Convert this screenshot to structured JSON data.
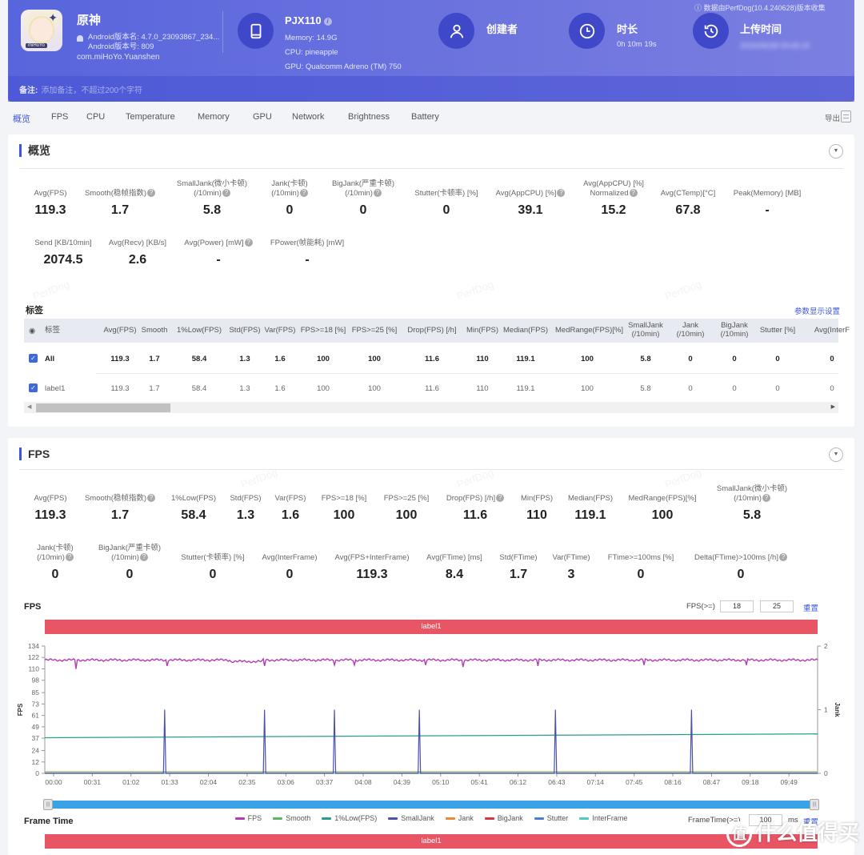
{
  "header": {
    "app": {
      "name": "原神",
      "version_name": "Android版本名: 4.7.0_23093867_234...",
      "version_code": "Android版本号: 809",
      "package": "com.miHoYo.Yuanshen",
      "icon_tag": "miHoYo"
    },
    "device": {
      "model": "PJX110",
      "memory": "Memory: 14.9G",
      "cpu": "CPU: pineapple",
      "gpu": "GPU: Qualcomm Adreno (TM) 750"
    },
    "creator": {
      "title": "创建者",
      "value": ""
    },
    "duration": {
      "title": "时长",
      "value": "0h 10m 19s"
    },
    "upload": {
      "title": "上传时间",
      "value": "2024/06/28 09:46:15"
    },
    "collected_by": "数据由PerfDog(10.4.240628)版本收集",
    "note_label": "备注:",
    "note_placeholder": "添加备注，不超过200个字符"
  },
  "tabs": [
    "概览",
    "FPS",
    "CPU",
    "Temperature",
    "Memory",
    "GPU",
    "Network",
    "Brightness",
    "Battery"
  ],
  "active_tab": "概览",
  "export_label": "导出",
  "overview": {
    "title": "概览",
    "metrics_row1": [
      {
        "label": "Avg(FPS)",
        "value": "119.3",
        "help": false
      },
      {
        "label": "Smooth(稳帧指数)",
        "value": "1.7",
        "help": true
      },
      {
        "label": "SmallJank(微小卡顿)\n(/10min)",
        "value": "5.8",
        "help": true
      },
      {
        "label": "Jank(卡顿)\n(/10min)",
        "value": "0",
        "help": true
      },
      {
        "label": "BigJank(严重卡顿)\n(/10min)",
        "value": "0",
        "help": true
      },
      {
        "label": "Stutter(卡顿率) [%]",
        "value": "0",
        "help": false
      },
      {
        "label": "Avg(AppCPU) [%]",
        "value": "39.1",
        "help": true
      },
      {
        "label": "Avg(AppCPU) [%]\nNormalized",
        "value": "15.2",
        "help": true
      },
      {
        "label": "Avg(CTemp)[°C]",
        "value": "67.8",
        "help": false
      },
      {
        "label": "Peak(Memory) [MB]",
        "value": "-",
        "help": false
      }
    ],
    "metrics_row2": [
      {
        "label": "Send [KB/10min]",
        "value": "2074.5",
        "help": false
      },
      {
        "label": "Avg(Recv) [KB/s]",
        "value": "2.6",
        "help": false
      },
      {
        "label": "Avg(Power) [mW]",
        "value": "-",
        "help": true
      },
      {
        "label": "FPower(帧能耗) [mW]",
        "value": "-",
        "help": false
      }
    ],
    "tags_title": "标签",
    "param_settings": "参数显示设置",
    "table": {
      "columns": [
        "标签",
        "Avg(FPS)",
        "Smooth",
        "1%Low(FPS)",
        "Std(FPS)",
        "Var(FPS)",
        "FPS>=18 [%]",
        "FPS>=25 [%]",
        "Drop(FPS) [/h]",
        "Min(FPS)",
        "Median(FPS)",
        "MedRange(FPS)[%]",
        "SmallJank\n(/10min)",
        "Jank\n(/10min)",
        "BigJank\n(/10min)",
        "Stutter [%]",
        "Avg(InterF"
      ],
      "rows": [
        {
          "name": "All",
          "checked": true,
          "values": [
            "119.3",
            "1.7",
            "58.4",
            "1.3",
            "1.6",
            "100",
            "100",
            "11.6",
            "110",
            "119.1",
            "100",
            "5.8",
            "0",
            "0",
            "0",
            "0"
          ]
        },
        {
          "name": "label1",
          "checked": true,
          "values": [
            "119.3",
            "1.7",
            "58.4",
            "1.3",
            "1.6",
            "100",
            "100",
            "11.6",
            "110",
            "119.1",
            "100",
            "5.8",
            "0",
            "0",
            "0",
            "0"
          ]
        }
      ]
    }
  },
  "fps_section": {
    "title": "FPS",
    "metrics_row1": [
      {
        "label": "Avg(FPS)",
        "value": "119.3",
        "help": false
      },
      {
        "label": "Smooth(稳帧指数)",
        "value": "1.7",
        "help": true
      },
      {
        "label": "1%Low(FPS)",
        "value": "58.4",
        "help": false
      },
      {
        "label": "Std(FPS)",
        "value": "1.3",
        "help": false
      },
      {
        "label": "Var(FPS)",
        "value": "1.6",
        "help": false
      },
      {
        "label": "FPS>=18 [%]",
        "value": "100",
        "help": false
      },
      {
        "label": "FPS>=25 [%]",
        "value": "100",
        "help": false
      },
      {
        "label": "Drop(FPS) [/h]",
        "value": "11.6",
        "help": true
      },
      {
        "label": "Min(FPS)",
        "value": "110",
        "help": false
      },
      {
        "label": "Median(FPS)",
        "value": "119.1",
        "help": false
      },
      {
        "label": "MedRange(FPS)[%]",
        "value": "100",
        "help": false
      },
      {
        "label": "SmallJank(微小卡顿)\n(/10min)",
        "value": "5.8",
        "help": true
      }
    ],
    "metrics_row2": [
      {
        "label": "Jank(卡顿)\n(/10min)",
        "value": "0",
        "help": true
      },
      {
        "label": "BigJank(严重卡顿)\n(/10min)",
        "value": "0",
        "help": true
      },
      {
        "label": "Stutter(卡顿率) [%]",
        "value": "0",
        "help": false
      },
      {
        "label": "Avg(InterFrame)",
        "value": "0",
        "help": false
      },
      {
        "label": "Avg(FPS+InterFrame)",
        "value": "119.3",
        "help": false
      },
      {
        "label": "Avg(FTime) [ms]",
        "value": "8.4",
        "help": false
      },
      {
        "label": "Std(FTime)",
        "value": "1.7",
        "help": false
      },
      {
        "label": "Var(FTime)",
        "value": "3",
        "help": false
      },
      {
        "label": "FTime>=100ms [%]",
        "value": "0",
        "help": false
      },
      {
        "label": "Delta(FTime)>100ms [/h]",
        "value": "0",
        "help": true
      }
    ],
    "chart_title": "FPS",
    "threshold_label": "FPS(>=)",
    "threshold1": "18",
    "threshold2": "25",
    "reset_label": "重置",
    "label_bar": "label1",
    "frame_time_title": "Frame Time",
    "frametime_label": "FrameTime(>=)",
    "frametime_value": "100",
    "frametime_unit": "ms",
    "frametime_reset": "重置",
    "frametime_label_bar": "label1"
  },
  "chart_data": {
    "type": "line",
    "title": "FPS",
    "xlabel": "",
    "ylabel": "FPS",
    "y2label": "Jank",
    "ylim": [
      0,
      134
    ],
    "y2lim": [
      0,
      2
    ],
    "yticks": [
      0,
      12,
      24,
      37,
      49,
      61,
      73,
      85,
      98,
      110,
      122,
      134
    ],
    "y2ticks": [
      0,
      1,
      2
    ],
    "xticks": [
      "00:00",
      "00:31",
      "01:02",
      "01:33",
      "02:04",
      "02:35",
      "03:06",
      "03:37",
      "04:08",
      "04:39",
      "05:10",
      "05:41",
      "06:12",
      "06:43",
      "07:14",
      "07:45",
      "08:16",
      "08:47",
      "09:18",
      "09:49"
    ],
    "duration_s": 619,
    "legend_position": "bottom",
    "series": [
      {
        "name": "FPS",
        "color": "#b33cb3",
        "axis": "left",
        "baseline": 119.3,
        "dips": [
          {
            "t": 25,
            "v": 110
          },
          {
            "t": 98,
            "v": 113
          },
          {
            "t": 176,
            "v": 113
          },
          {
            "t": 232,
            "v": 114
          },
          {
            "t": 248,
            "v": 114
          },
          {
            "t": 305,
            "v": 114
          },
          {
            "t": 335,
            "v": 112
          },
          {
            "t": 395,
            "v": 113
          },
          {
            "t": 480,
            "v": 114
          },
          {
            "t": 562,
            "v": 114
          }
        ]
      },
      {
        "name": "Smooth",
        "color": "#5cb85c",
        "axis": "left",
        "value": 1.7
      },
      {
        "name": "1%Low(FPS)",
        "color": "#2a9d8f",
        "axis": "left",
        "start": 37.5,
        "end": 41.5
      },
      {
        "name": "SmallJank",
        "color": "#4b4fb0",
        "axis": "right",
        "spikes_s": [
          96,
          176,
          232,
          300,
          409,
          518
        ],
        "spike_value": 1
      },
      {
        "name": "Jank",
        "color": "#f0883a",
        "axis": "right",
        "value": 0
      },
      {
        "name": "BigJank",
        "color": "#d9363e",
        "axis": "right",
        "value": 0
      },
      {
        "name": "Stutter",
        "color": "#4a7fd0",
        "axis": "left",
        "value": 0
      },
      {
        "name": "InterFrame",
        "color": "#52c7c7",
        "axis": "left",
        "value": 0
      }
    ]
  }
}
